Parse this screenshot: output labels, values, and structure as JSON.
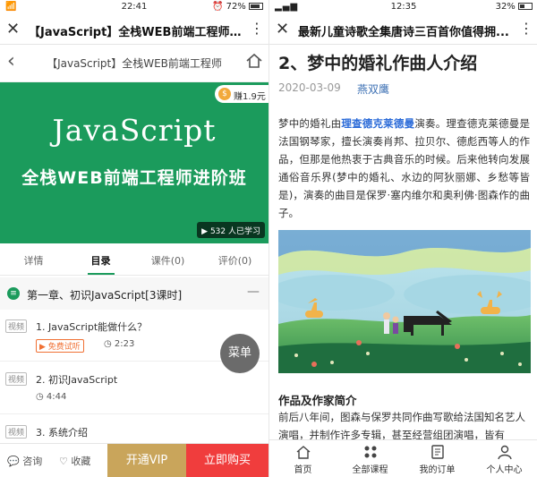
{
  "left": {
    "status": {
      "signal": "📶",
      "time": "22:41",
      "battery": "72%"
    },
    "titlebar": {
      "title": "【JavaScript】全栈WEB前端工程师进..."
    },
    "nav": {
      "title": "【JavaScript】全栈WEB前端工程师"
    },
    "banner": {
      "earn": "赚1.9元",
      "coin": "$",
      "headline": "JavaScript",
      "subheadline": "全栈WEB前端工程师进阶班",
      "learners": "532 人已学习"
    },
    "tabs": [
      "详情",
      "目录",
      "课件(0)",
      "评价(0)"
    ],
    "chapter": {
      "title": "第一章、初识JavaScript[3课时]",
      "icon": "≡",
      "toggle": "—"
    },
    "lessons": [
      {
        "tag": "视频",
        "name": "1. JavaScript能做什么？",
        "free": "免费试听",
        "duration": "2:23"
      },
      {
        "tag": "视频",
        "name": "2. 初识JavaScript",
        "duration": "4:44"
      },
      {
        "tag": "视频",
        "name": "3. 系统介绍"
      }
    ],
    "menu_fab": "菜单",
    "bottom": {
      "consult": "咨询",
      "favorite": "收藏",
      "vip": "开通VIP",
      "buy": "立即购买"
    },
    "colors": {
      "brand_green": "#1b9b5c",
      "vip_gold": "#c9a55b",
      "buy_red": "#f03d3d"
    }
  },
  "right": {
    "status": {
      "time": "12:35",
      "battery": "32%"
    },
    "titlebar": {
      "title": "最新儿童诗歌全集唐诗三百首你值得拥..."
    },
    "article": {
      "title": "2、梦中的婚礼作曲人介绍",
      "date": "2020-03-09",
      "author": "燕双鹰",
      "p1_pre": "梦中的婚礼由",
      "p1_link": "理查德克莱德曼",
      "p1_post": "演奏。理查德克莱德曼是法国钢琴家，擅长演奏肖邦、拉贝尔、德彪西等人的作品，但那是他热衷于古典音乐的时候。后来他转向发展通俗音乐界(梦中的婚礼、水边的阿狄丽娜、乡愁等皆是)，演奏的曲目是保罗·塞内维尔和奥利佛·图森作的曲子。",
      "section": "作品及作家简介",
      "p2": "前后八年间，图森与保罗共同作曲写歌给法国知名艺人演唱，并制作许多专辑，甚至经营组团演唱，皆有"
    },
    "bottom": [
      "首页",
      "全部课程",
      "我的订单",
      "个人中心"
    ]
  }
}
